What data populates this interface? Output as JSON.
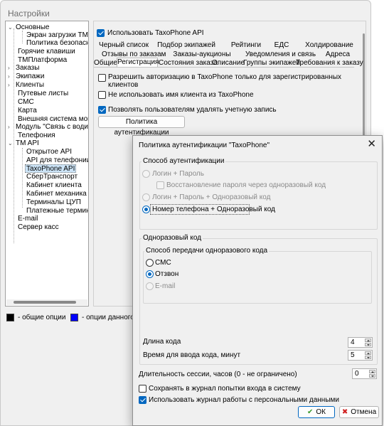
{
  "window": {
    "title": "Настройки"
  },
  "tree": {
    "items": [
      {
        "label": "Основные",
        "exp": "⌄"
      },
      {
        "label": "Экран загрузки ТМ"
      },
      {
        "label": "Политика безопасност"
      },
      {
        "label": "Горячие клавиши"
      },
      {
        "label": "ТМПлатформа"
      },
      {
        "label": "Заказы",
        "exp": "›"
      },
      {
        "label": "Экипажи",
        "exp": "›"
      },
      {
        "label": "Клиенты",
        "exp": "›"
      },
      {
        "label": "Путевые листы"
      },
      {
        "label": "СМС"
      },
      {
        "label": "Карта"
      },
      {
        "label": "Внешняя система мониторинга"
      },
      {
        "label": "Модуль \"Связь с водителем\"",
        "exp": "›"
      },
      {
        "label": "Телефония"
      },
      {
        "label": "TM API",
        "exp": "⌄"
      },
      {
        "label": "Открытое API"
      },
      {
        "label": "API для телефонии"
      },
      {
        "label": "TaxoPhone API"
      },
      {
        "label": "СберТранспорт"
      },
      {
        "label": "Кабинет клиента"
      },
      {
        "label": "Кабинет механика"
      },
      {
        "label": "Терминалы ЦУП"
      },
      {
        "label": "Платежные терминалы"
      },
      {
        "label": "E-mail"
      },
      {
        "label": "Сервер касс"
      }
    ]
  },
  "legend": {
    "general": "- общие опции",
    "data_option": "- опции данного раб",
    "general_color": "#000000",
    "data_color": "#0000ff"
  },
  "panel": {
    "use_taxophone": "Использовать TaxoPhone API",
    "tabs_row1": [
      "Черный список",
      "Подбор экипажей",
      "Рейтинги",
      "ЕДС",
      "Холдирование"
    ],
    "tabs_row2": [
      "Отзывы по заказам",
      "Заказы-аукционы",
      "Уведомления и связь",
      "Адреса"
    ],
    "tabs_row3": [
      "Общие",
      "Регистрация",
      "Состояния заказа",
      "Описание",
      "Группы экипажей",
      "Требования к заказу"
    ],
    "allow_auth_line1": "Разрешить авторизацию в TaxoPhone только для зарегистрированных",
    "allow_auth_line2": "клиентов",
    "no_client_name": "Не использовать имя клиента из TaxoPhone",
    "allow_delete": "Позволять пользователям удалять учетную запись",
    "policy_button": "Политика аутентификации"
  },
  "dialog": {
    "title": "Политика аутентификации \"TaxoPhone\"",
    "close": "✕",
    "auth_group": "Способ аутентификации",
    "login_password": "Логин + Пароль",
    "restore_password": "Восстановление пароля через одноразовый код",
    "login_password_otp": "Логин + Пароль + Одноразовый код",
    "phone_otp": "Номер телефона + Одноразовый код",
    "otp_group": "Одноразовый код",
    "transfer_group": "Способ передачи одноразового кода",
    "sms": "СМС",
    "callback": "Отзвон",
    "email": "E-mail",
    "code_length_label": "Длина кода",
    "code_length": "4",
    "input_time_label": "Время для ввода кода, минут",
    "input_time": "5",
    "session_label": "Длительность сессии, часов (0 - не ограничено)",
    "session": "0",
    "log_attempts": "Сохранять в журнал попытки входа в систему",
    "use_personal_log": "Использовать журнал работы с персональными данными",
    "ok": "ОК",
    "cancel": "Отмена"
  }
}
